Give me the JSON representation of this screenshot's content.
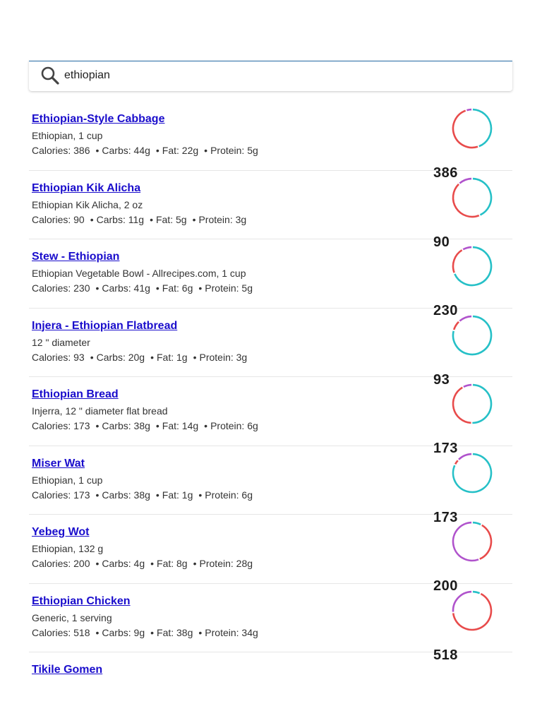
{
  "search": {
    "query": "ethiopian",
    "icon": "search-icon"
  },
  "colors": {
    "carbs": "#26c0c7",
    "fat": "#e84b4b",
    "protein": "#b053cc",
    "link": "#1a0dcc",
    "search_border": "#2a6fa8"
  },
  "results": [
    {
      "title": "Ethiopian-Style Cabbage",
      "description": "Ethiopian, 1 cup",
      "calories_label": "Calories: 386",
      "carbs_label": "Carbs: 44g",
      "fat_label": "Fat: 22g",
      "protein_label": "Protein: 5g",
      "calories": "386",
      "carbs_g": 44,
      "fat_g": 22,
      "protein_g": 5
    },
    {
      "title": "Ethiopian Kik Alicha",
      "description": "Ethiopian Kik Alicha, 2 oz",
      "calories_label": "Calories: 90",
      "carbs_label": "Carbs: 11g",
      "fat_label": "Fat: 5g",
      "protein_label": "Protein: 3g",
      "calories": "90",
      "carbs_g": 11,
      "fat_g": 5,
      "protein_g": 3
    },
    {
      "title": "Stew - Ethiopian",
      "description": "Ethiopian Vegetable Bowl - Allrecipes.com, 1 cup",
      "calories_label": "Calories: 230",
      "carbs_label": "Carbs: 41g",
      "fat_label": "Fat: 6g",
      "protein_label": "Protein: 5g",
      "calories": "230",
      "carbs_g": 41,
      "fat_g": 6,
      "protein_g": 5
    },
    {
      "title": "Injera - Ethiopian Flatbread",
      "description": "12 \" diameter",
      "calories_label": "Calories: 93",
      "carbs_label": "Carbs: 20g",
      "fat_label": "Fat: 1g",
      "protein_label": "Protein: 3g",
      "calories": "93",
      "carbs_g": 20,
      "fat_g": 1,
      "protein_g": 3
    },
    {
      "title": "Ethiopian Bread",
      "description": "Injerra, 12 \" diameter flat bread",
      "calories_label": "Calories: 173",
      "carbs_label": "Carbs: 38g",
      "fat_label": "Fat: 14g",
      "protein_label": "Protein: 6g",
      "calories": "173",
      "carbs_g": 38,
      "fat_g": 14,
      "protein_g": 6
    },
    {
      "title": "Miser Wat",
      "description": "Ethiopian, 1 cup",
      "calories_label": "Calories: 173",
      "carbs_label": "Carbs: 38g",
      "fat_label": "Fat: 1g",
      "protein_label": "Protein: 6g",
      "calories": "173",
      "carbs_g": 38,
      "fat_g": 1,
      "protein_g": 6
    },
    {
      "title": "Yebeg Wot",
      "description": "Ethiopian, 132 g",
      "calories_label": "Calories: 200",
      "carbs_label": "Carbs: 4g",
      "fat_label": "Fat: 8g",
      "protein_label": "Protein: 28g",
      "calories": "200",
      "carbs_g": 4,
      "fat_g": 8,
      "protein_g": 28
    },
    {
      "title": "Ethiopian Chicken",
      "description": "Generic, 1 serving",
      "calories_label": "Calories: 518",
      "carbs_label": "Carbs: 9g",
      "fat_label": "Fat: 38g",
      "protein_label": "Protein: 34g",
      "calories": "518",
      "carbs_g": 9,
      "fat_g": 38,
      "protein_g": 34
    },
    {
      "title": "Tikile Gomen"
    }
  ]
}
